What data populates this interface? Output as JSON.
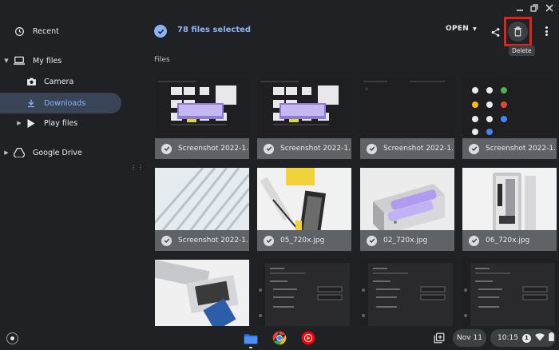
{
  "window": {
    "controls": [
      "minimize",
      "maximize",
      "close"
    ]
  },
  "sidebar": {
    "recent": "Recent",
    "my_files": "My files",
    "camera": "Camera",
    "downloads": "Downloads",
    "play_files": "Play files",
    "google_drive": "Google Drive"
  },
  "header": {
    "selection_text": "78 files selected",
    "open_label": "OPEN",
    "delete_tooltip": "Delete"
  },
  "section_label": "Files",
  "files": [
    {
      "name": "Screenshot 2022-1...",
      "kind": "screenshot-settings"
    },
    {
      "name": "Screenshot 2022-1...",
      "kind": "screenshot-settings"
    },
    {
      "name": "Screenshot 2022-1...",
      "kind": "screenshot-dark"
    },
    {
      "name": "Screenshot 2022-1...",
      "kind": "screenshot-apps"
    },
    {
      "name": "Screenshot 2022-1...",
      "kind": "architecture"
    },
    {
      "name": "05_720x.jpg",
      "kind": "product-cables"
    },
    {
      "name": "02_720x.jpg",
      "kind": "product-box"
    },
    {
      "name": "06_720x.jpg",
      "kind": "product-vertical"
    },
    {
      "name": "",
      "kind": "product-laptop"
    },
    {
      "name": "",
      "kind": "screenshot-dialog"
    },
    {
      "name": "",
      "kind": "screenshot-dialog"
    },
    {
      "name": "",
      "kind": "screenshot-dialog"
    }
  ],
  "shelf": {
    "apps": [
      "files-app",
      "chrome-app",
      "youtube-music-app"
    ],
    "date": "Nov 11",
    "time": "10:15",
    "notification_count": "1"
  },
  "colors": {
    "accent": "#8ab4f8",
    "highlight_box": "#e0241b",
    "background": "#202124"
  }
}
